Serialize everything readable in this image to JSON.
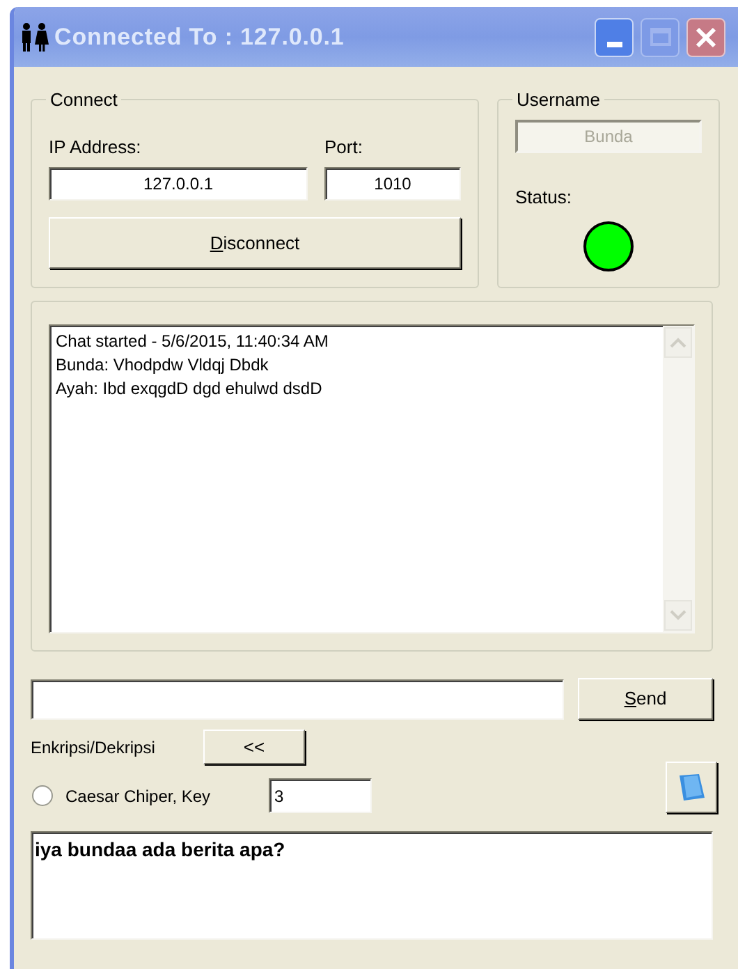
{
  "window": {
    "title": "Connected To : 127.0.0.1",
    "maximize_disabled": true
  },
  "connect": {
    "legend": "Connect",
    "ip_label": "IP Address:",
    "ip_value": "127.0.0.1",
    "port_label": "Port:",
    "port_value": "1010",
    "button": "Disconnect"
  },
  "user": {
    "legend": "Username",
    "username": "Bunda",
    "username_disabled": true,
    "status_label": "Status:",
    "connected": true
  },
  "chat": {
    "lines": [
      "Chat started - 5/6/2015, 11:40:34 AM",
      "Bunda: Vhodpdw Vldqj Dbdk",
      "Ayah: Ibd exqgdD dgd ehulwd dsdD"
    ]
  },
  "send_button": "Send",
  "crypto": {
    "label": "Enkripsi/Dekripsi",
    "swap_button": "<<",
    "radio_label": "Caesar Chiper, Key",
    "radio_checked": false,
    "key": "3"
  },
  "output": {
    "text": "iya bundaa ada berita apa?"
  }
}
